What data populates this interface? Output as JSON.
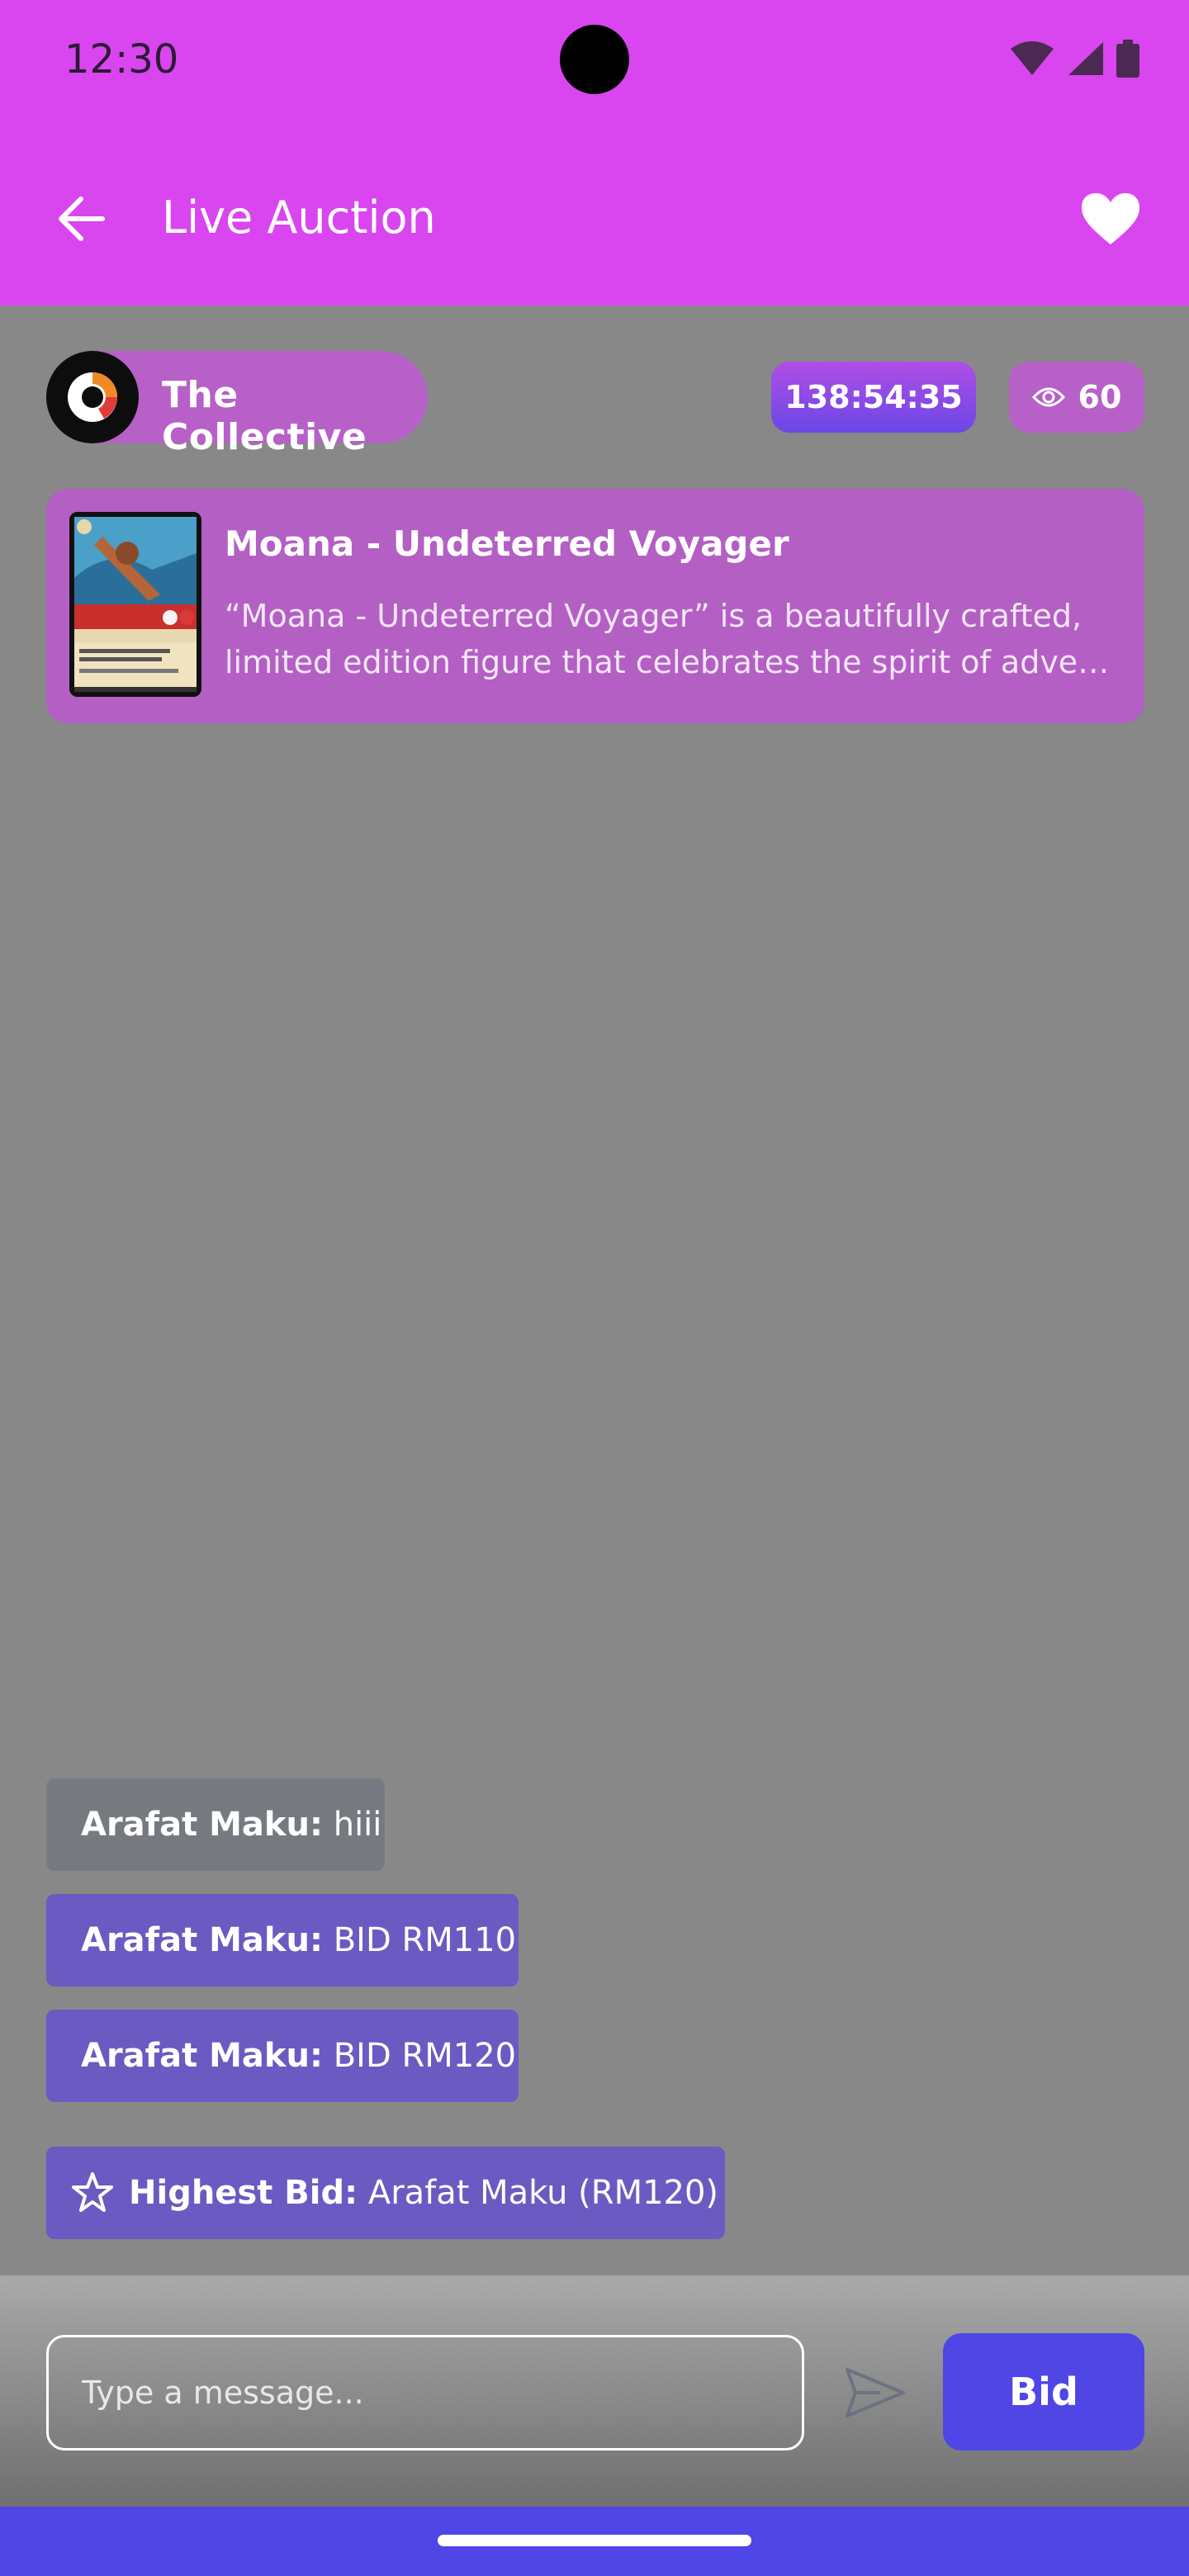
{
  "status_bar": {
    "time": "12:30"
  },
  "app_bar": {
    "title": "Live Auction"
  },
  "seller": {
    "name": "The Collective"
  },
  "auction": {
    "timer": "138:54:35",
    "viewers": "60"
  },
  "product": {
    "title": "Moana - Undeterred Voyager",
    "description_line1": "“Moana - Undeterred Voyager” is a beautifully crafted,",
    "description_line2": "limited edition figure that celebrates the spirit of adventu…"
  },
  "messages": [
    {
      "user": "Arafat Maku:",
      "text": "hiii",
      "style": "gray"
    },
    {
      "user": "Arafat Maku:",
      "text": "BID RM110",
      "style": "purple"
    },
    {
      "user": "Arafat Maku:",
      "text": "BID RM120",
      "style": "purple"
    }
  ],
  "highest_bid": {
    "label": "Highest Bid:",
    "value": "Arafat Maku (RM120)"
  },
  "composer": {
    "placeholder": "Type a message...",
    "bid_label": "Bid"
  },
  "colors": {
    "primary": "#d946ef",
    "accent": "#4f46e5",
    "bubble": "#6a5ac2"
  }
}
